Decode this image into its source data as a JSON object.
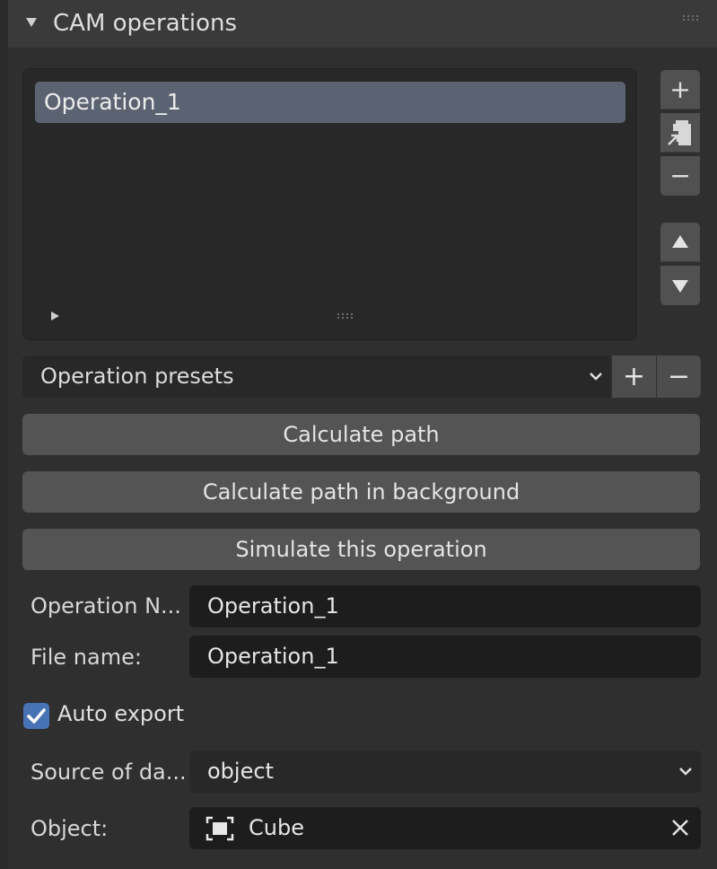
{
  "panel": {
    "title": "CAM operations",
    "grip_icon": "grip-dots-icon"
  },
  "operations_list": {
    "items": [
      {
        "label": "Operation_1",
        "selected": true
      }
    ],
    "side_buttons": {
      "add": "+",
      "copy_icon": "copy-operation-icon",
      "remove": "−",
      "move_up_icon": "triangle-up-icon",
      "move_down_icon": "triangle-down-icon"
    }
  },
  "presets": {
    "label": "Operation presets",
    "add": "+",
    "remove": "−"
  },
  "actions": {
    "calculate_path": "Calculate path",
    "calculate_background": "Calculate path in background",
    "simulate": "Simulate this operation"
  },
  "properties": {
    "operation_name_label": "Operation N...",
    "operation_name_value": "Operation_1",
    "file_name_label": "File name:",
    "file_name_value": "Operation_1",
    "auto_export_label": "Auto export",
    "auto_export_checked": true,
    "source_label": "Source of da...",
    "source_value": "object",
    "object_label": "Object:",
    "object_value": "Cube"
  },
  "colors": {
    "accent": "#4772b3",
    "selected_row": "#5b6373"
  }
}
